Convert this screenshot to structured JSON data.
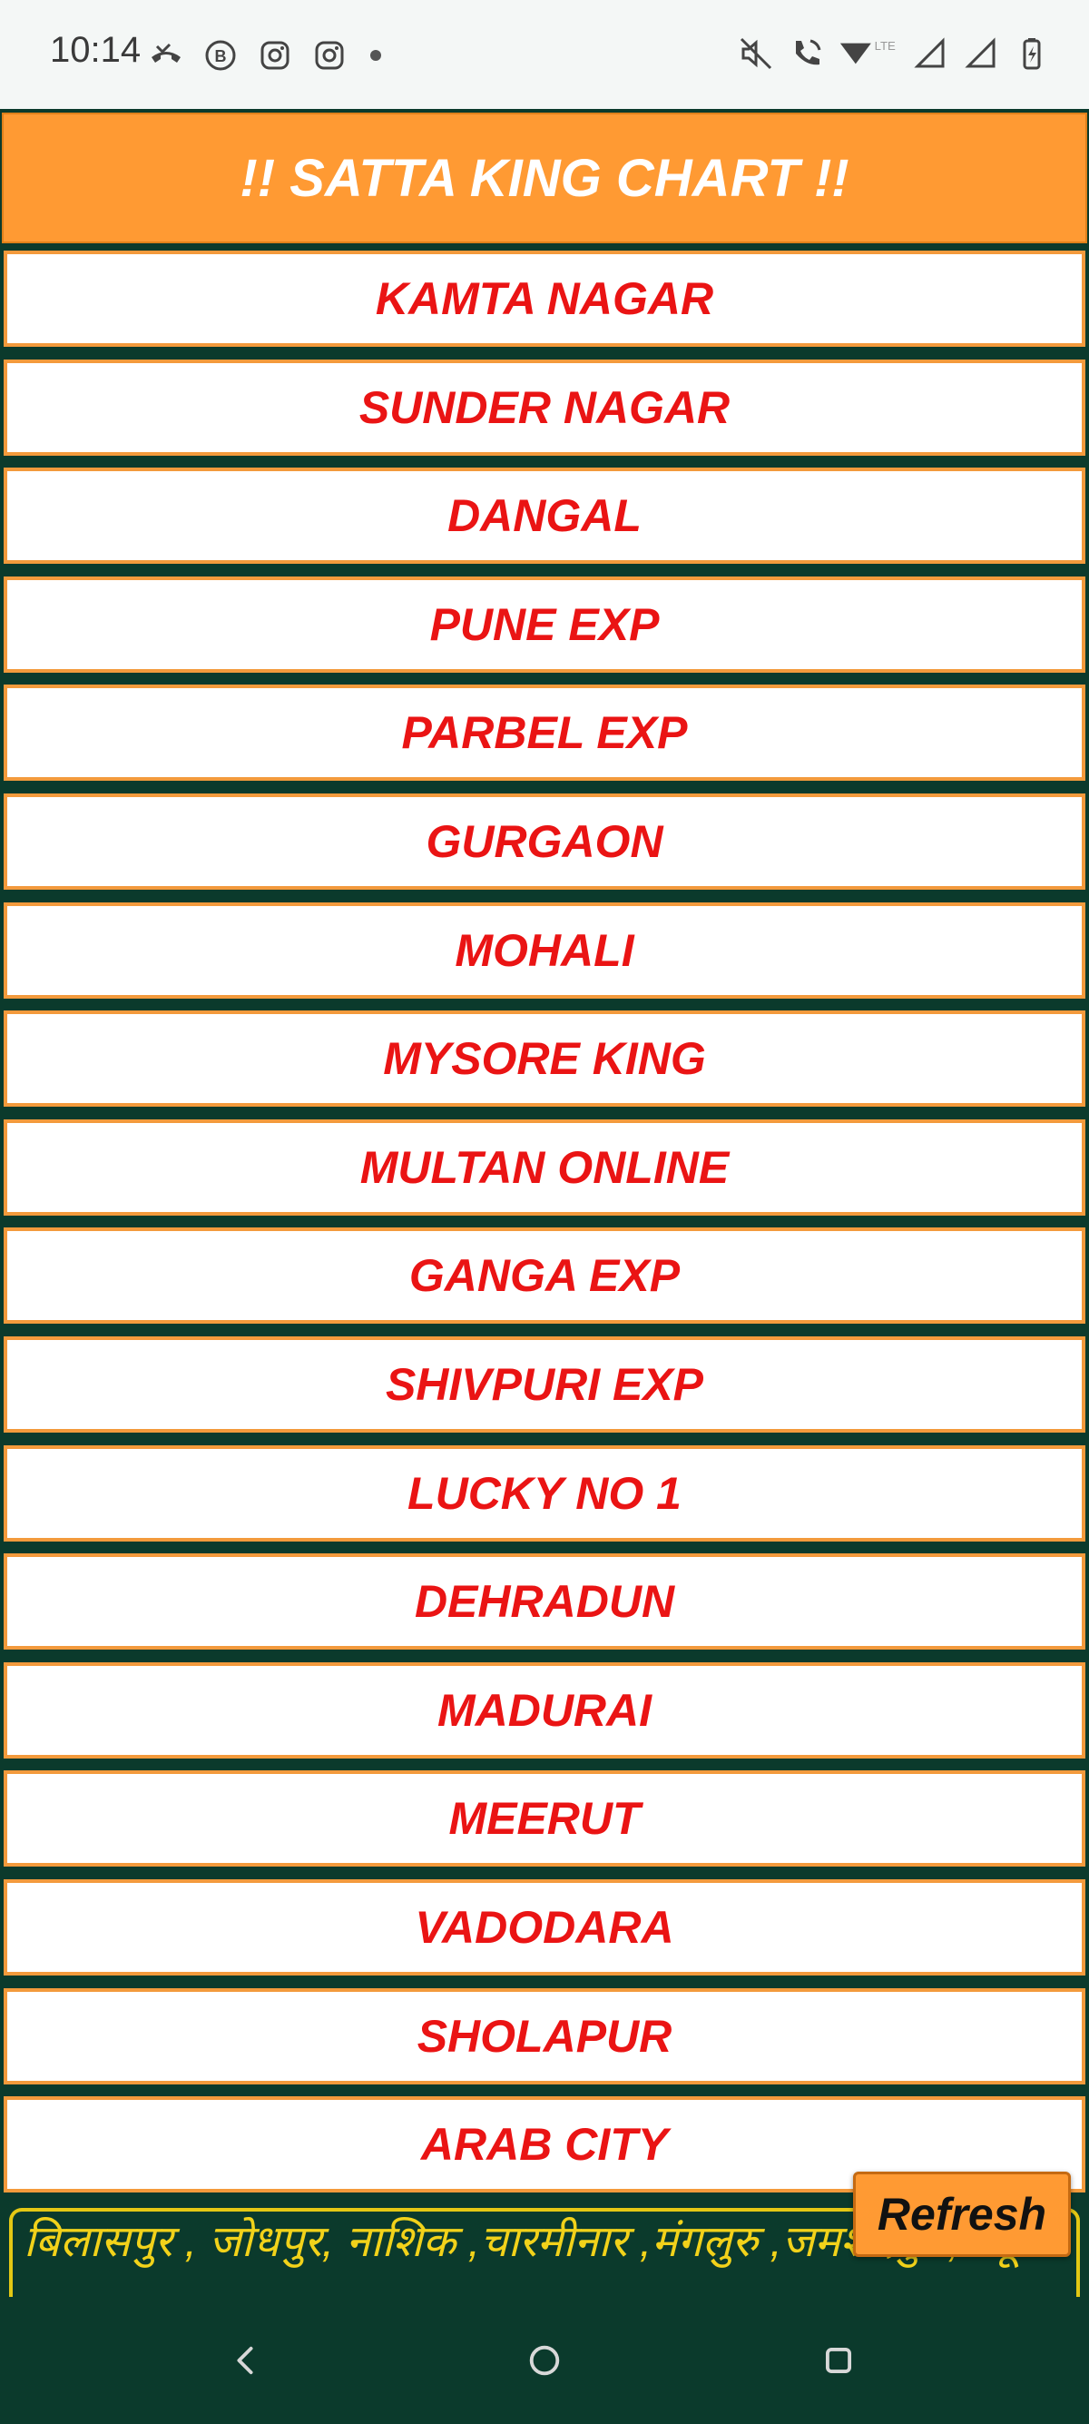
{
  "status_bar": {
    "time": "10:14",
    "left_icons": [
      "missed-call-icon",
      "whatsapp-business-icon",
      "instagram-icon",
      "instagram-icon",
      "dot-icon"
    ],
    "right_icons": [
      "mute-icon",
      "wifi-call-icon",
      "signal-lte-icon",
      "signal-icon",
      "signal-icon",
      "battery-charging-icon"
    ],
    "network_label": "LTE"
  },
  "header": {
    "title": "!! SATTA KING CHART !!"
  },
  "list": {
    "items": [
      "KAMTA NAGAR",
      "SUNDER NAGAR",
      "DANGAL",
      "PUNE EXP",
      "PARBEL EXP",
      "GURGAON",
      "MOHALI",
      "MYSORE KING",
      "MULTAN ONLINE",
      "GANGA EXP",
      "SHIVPURI EXP",
      "LUCKY NO 1",
      "DEHRADUN",
      "MADURAI",
      "MEERUT",
      "VADODARA",
      "SHOLAPUR",
      "ARAB CITY"
    ]
  },
  "refresh_label": "Refresh",
  "ticker_text": "बिलासपुर , जोधपुर, नाशिक ,चारमीनार ,मंगलुरु ,जमशेदपुर ,मैसूर",
  "colors": {
    "background": "#0b3a2c",
    "header_bg": "#ff9a33",
    "item_border": "#f39a3c",
    "item_text": "#ea1414",
    "ticker_text": "#f2d21a"
  }
}
